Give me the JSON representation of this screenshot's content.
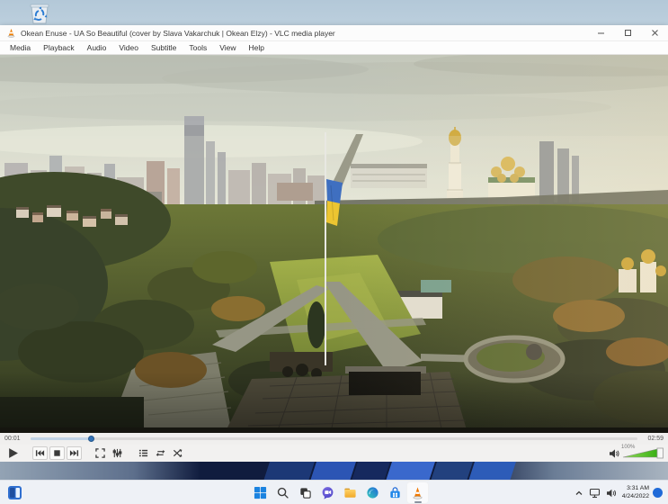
{
  "titlebar": {
    "title": "Okean Enuse - UA So Beautiful (cover by Slava Vakarchuk | Okean Elzy) - VLC media player",
    "window_controls": [
      "minimize",
      "maximize",
      "close"
    ]
  },
  "menubar": {
    "items": [
      "Media",
      "Playback",
      "Audio",
      "Video",
      "Subtitle",
      "Tools",
      "View",
      "Help"
    ]
  },
  "player": {
    "elapsed": "00:01",
    "duration": "02:59",
    "progress_percent": 10,
    "volume_label": "100%",
    "volume_color": "#45bd1c",
    "controls": [
      "play",
      "previous",
      "stop",
      "next",
      "fullscreen",
      "extended-settings",
      "playlist",
      "loop",
      "random"
    ]
  },
  "desktop": {
    "icons": [
      "recycle-bin"
    ]
  },
  "taskbar": {
    "apps": [
      "widgets",
      "start",
      "search",
      "task-view",
      "chat",
      "file-explorer",
      "edge",
      "store",
      "vlc"
    ],
    "active_app": "vlc"
  },
  "tray": {
    "icons": [
      "hidden-icons-chevron",
      "network",
      "volume"
    ],
    "time": "3:31 AM",
    "date": "4/24/2022"
  }
}
